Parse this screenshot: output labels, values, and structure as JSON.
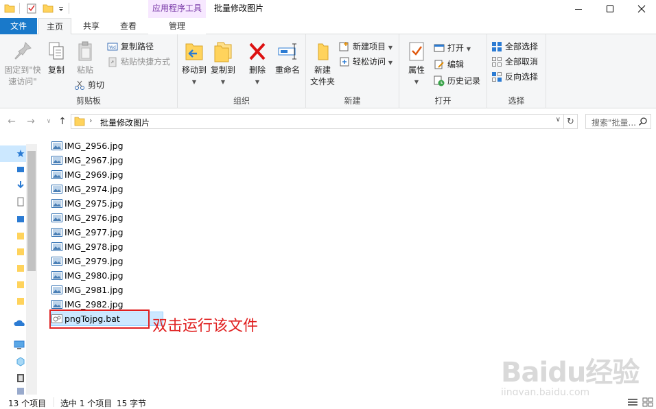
{
  "window": {
    "title": "批量修改图片",
    "contextual_group_label": "应用程序工具"
  },
  "tabs": {
    "file": "文件",
    "home": "主页",
    "share": "共享",
    "view": "查看",
    "manage": "管理"
  },
  "ribbon": {
    "clipboard": {
      "label": "剪贴板",
      "pin": "固定到\"快速访问\"",
      "copy": "复制",
      "paste": "粘贴",
      "copy_path": "复制路径",
      "paste_shortcut": "粘贴快捷方式",
      "cut": "剪切"
    },
    "organize": {
      "label": "组织",
      "move_to": "移动到",
      "copy_to": "复制到",
      "delete": "删除",
      "rename": "重命名"
    },
    "new": {
      "label": "新建",
      "new_folder": "新建\n文件夹",
      "new_item": "新建项目",
      "easy_access": "轻松访问"
    },
    "open": {
      "label": "打开",
      "properties": "属性",
      "open": "打开",
      "edit": "编辑",
      "history": "历史记录"
    },
    "select": {
      "label": "选择",
      "select_all": "全部选择",
      "select_none": "全部取消",
      "invert": "反向选择"
    }
  },
  "address": {
    "path": "批量修改图片",
    "search_placeholder": "搜索\"批量..."
  },
  "files": [
    {
      "name": "IMG_2956.jpg",
      "type": "jpg"
    },
    {
      "name": "IMG_2967.jpg",
      "type": "jpg"
    },
    {
      "name": "IMG_2969.jpg",
      "type": "jpg"
    },
    {
      "name": "IMG_2974.jpg",
      "type": "jpg"
    },
    {
      "name": "IMG_2975.jpg",
      "type": "jpg"
    },
    {
      "name": "IMG_2976.jpg",
      "type": "jpg"
    },
    {
      "name": "IMG_2977.jpg",
      "type": "jpg"
    },
    {
      "name": "IMG_2978.jpg",
      "type": "jpg"
    },
    {
      "name": "IMG_2979.jpg",
      "type": "jpg"
    },
    {
      "name": "IMG_2980.jpg",
      "type": "jpg"
    },
    {
      "name": "IMG_2981.jpg",
      "type": "jpg"
    },
    {
      "name": "IMG_2982.jpg",
      "type": "jpg"
    },
    {
      "name": "pngTojpg.bat",
      "type": "bat",
      "selected": true
    }
  ],
  "annotation": "双击运行该文件",
  "status": {
    "count": "13 个项目",
    "selected": "选中 1 个项目",
    "size": "15 字节"
  },
  "watermark": {
    "logo": "Baidu经验",
    "url": "jingyan.baidu.com"
  },
  "colors": {
    "accent": "#1979ca",
    "selection": "#cce8ff",
    "annotation": "#e02020",
    "context_tab": "#f7e8ff"
  }
}
